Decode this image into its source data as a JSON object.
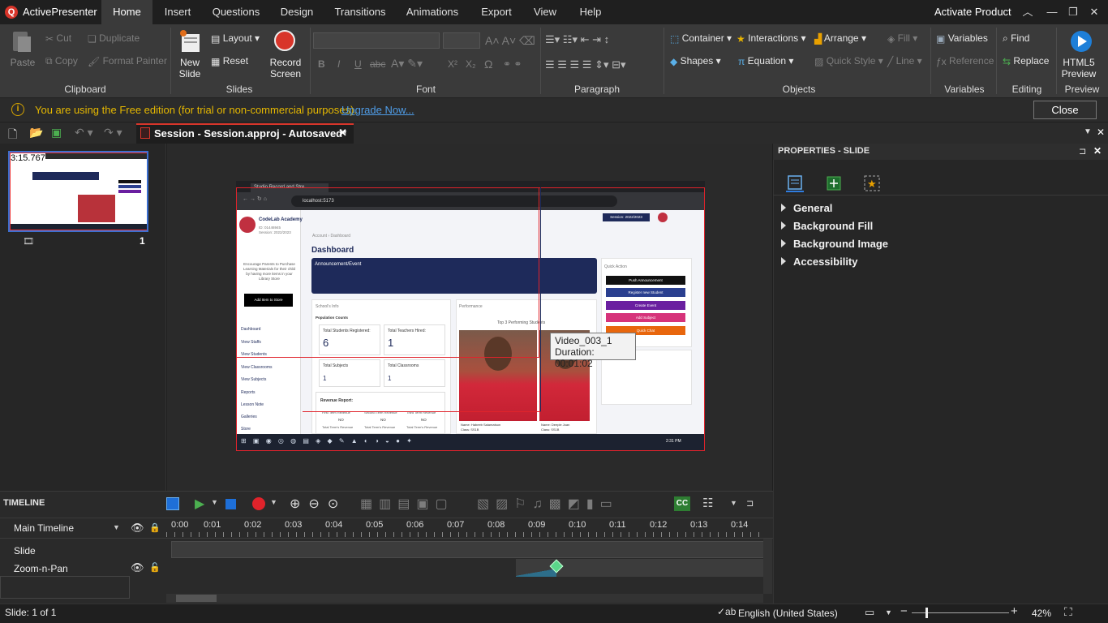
{
  "app": {
    "name": "ActivePresenter",
    "logo_letter": "Q",
    "activate_label": "Activate Product"
  },
  "menu": {
    "tabs": [
      "Home",
      "Insert",
      "Questions",
      "Design",
      "Transitions",
      "Animations",
      "Export",
      "View",
      "Help"
    ],
    "active": "Home"
  },
  "ribbon": {
    "clipboard": {
      "paste": "Paste",
      "cut": "Cut",
      "copy": "Copy",
      "duplicate": "Duplicate",
      "format_painter": "Format Painter",
      "label": "Clipboard"
    },
    "slides": {
      "new_slide": "New Slide",
      "layout": "Layout",
      "reset": "Reset",
      "record_screen": "Record Screen",
      "label": "Slides"
    },
    "font": {
      "label": "Font",
      "bold": "B",
      "italic": "I",
      "underline": "U",
      "strike": "abc",
      "superscript": "X²",
      "subscript": "X₂",
      "symbol": "Ω"
    },
    "paragraph": {
      "label": "Paragraph"
    },
    "objects": {
      "container": "Container",
      "interactions": "Interactions",
      "arrange": "Arrange",
      "fill": "Fill",
      "shapes": "Shapes",
      "equation": "Equation",
      "quick_style": "Quick Style",
      "line": "Line",
      "label": "Objects"
    },
    "variables": {
      "variables": "Variables",
      "reference": "Reference",
      "label": "Variables"
    },
    "editing": {
      "find": "Find",
      "replace": "Replace",
      "label": "Editing"
    },
    "preview": {
      "html5_preview": "HTML5 Preview",
      "label": "Preview"
    }
  },
  "notice": {
    "text": "You are using the Free edition (for trial or non-commercial purposes).",
    "link": "Upgrade Now...",
    "close": "Close"
  },
  "document": {
    "tab_title": "Session - Session.approj - Autosaved*"
  },
  "slide_panel": {
    "thumb_time": "3:15.767",
    "slide_number": "1"
  },
  "canvas": {
    "tooltip_name": "Video_003_1",
    "tooltip_duration": "Duration: 00:01:02",
    "browser": {
      "tab_title": "Studio Record and Stre",
      "url": "localhost:5173"
    },
    "school": {
      "name": "CodeLab Academy",
      "id": "ID: 01446945",
      "session": "Session: 2022/2023",
      "session_select": "Session: 2022/2023"
    },
    "promo_text": "Encourage Parents to Purchase Learning Materials for their child by having more items in your Library Store",
    "add_store": "Add Item to Store",
    "nav": [
      "View Staffs",
      "View Students",
      "View Classrooms",
      "View Subjects",
      "Reports",
      "Lesson Note",
      "Galleries",
      "Store"
    ],
    "nav_first": "Dashboard",
    "breadcrumb": [
      "Account",
      "Dashboard"
    ],
    "page_title": "Dashboard",
    "announcement": "Announcement/Event",
    "school_info": "School's Info",
    "pop_counts": "Population Counts",
    "stats": [
      {
        "label": "Total Students Registered:",
        "value": "6"
      },
      {
        "label": "Total Teachers Hired:",
        "value": "1"
      },
      {
        "label": "Total Subjects",
        "value": "1"
      },
      {
        "label": "Total Classrooms",
        "value": "1"
      }
    ],
    "revenue": "Revenue Report:",
    "revenue_cols": [
      "First Term Revenue",
      "Second Term Revenue",
      "Third Term Revenue"
    ],
    "revenue_val": "NO",
    "revenue_sub": "Total Term's Revenue",
    "performance": "Performance",
    "top_students": "Top 3 Performing Students",
    "students": [
      {
        "name": "Name: Habeeb Salamatson",
        "class": "Class: SS1B"
      },
      {
        "name": "Name: Deeple Joan",
        "class": "Class: SS1B"
      }
    ],
    "quick_action": "Quick Action",
    "actions": [
      {
        "label": "Push Announcement",
        "color": "#111111"
      },
      {
        "label": "Register new Student",
        "color": "#2a3f8f"
      },
      {
        "label": "Create Event",
        "color": "#6a1fa0"
      },
      {
        "label": "Add Subject",
        "color": "#d6337a"
      },
      {
        "label": "Quick Chat",
        "color": "#e8660d"
      }
    ],
    "taskbar_time": "2:31 PM"
  },
  "properties": {
    "title": "PROPERTIES - SLIDE",
    "items": [
      "General",
      "Background Fill",
      "Background Image",
      "Accessibility"
    ]
  },
  "timeline": {
    "title": "TIMELINE",
    "main": "Main Timeline",
    "rows": [
      "Slide",
      "Zoom-n-Pan"
    ],
    "ticks": [
      "0:00",
      "0:01",
      "0:02",
      "0:03",
      "0:04",
      "0:05",
      "0:06",
      "0:07",
      "0:08",
      "0:09",
      "0:10",
      "0:11",
      "0:12",
      "0:13",
      "0:14"
    ]
  },
  "status": {
    "slide_count": "Slide: 1 of 1",
    "language": "English (United States)",
    "zoom": "42%"
  }
}
